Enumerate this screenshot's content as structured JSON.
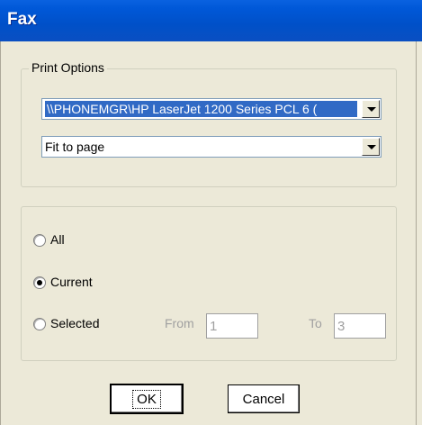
{
  "window": {
    "title": "Fax"
  },
  "print_options": {
    "legend": "Print Options",
    "printer": {
      "value": "\\\\PHONEMGR\\HP LaserJet 1200 Series PCL 6 ("
    },
    "scaling": {
      "value": "Fit to page"
    }
  },
  "range": {
    "all_label": "All",
    "current_label": "Current",
    "selected_label": "Selected",
    "selected_option": "Current",
    "from_label": "From",
    "from_value": "1",
    "to_label": "To",
    "to_value": "3"
  },
  "buttons": {
    "ok": "OK",
    "cancel": "Cancel"
  },
  "icons": {
    "dropdown": "chevron-down-icon",
    "radio": "radio-button-icon"
  }
}
